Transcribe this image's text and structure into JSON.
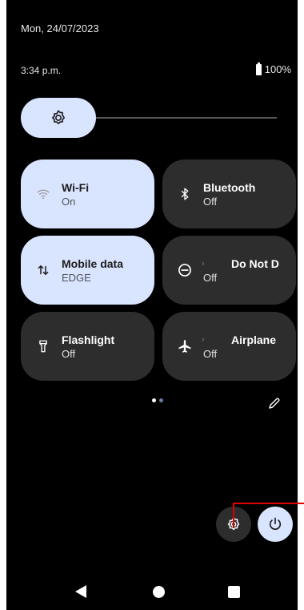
{
  "status": {
    "date": "Mon, 24/07/2023",
    "time": "3:34 p.m.",
    "battery": "100%"
  },
  "brightness": {
    "icon": "brightness-gear-icon",
    "level": 0
  },
  "tiles": [
    {
      "label": "Wi-Fi",
      "status": "On",
      "icon": "wifi-icon",
      "active": true
    },
    {
      "label": "Bluetooth",
      "status": "Off",
      "icon": "bluetooth-icon",
      "active": false
    },
    {
      "label": "Mobile data",
      "status": "EDGE",
      "icon": "mobile-data-arrows-icon",
      "active": true
    },
    {
      "label": "Do Not D",
      "status": "Off",
      "icon": "do-not-disturb-icon",
      "active": false
    },
    {
      "label": "Flashlight",
      "status": "Off",
      "icon": "flashlight-icon",
      "active": false
    },
    {
      "label": "Airplane",
      "status": "Off",
      "icon": "airplane-icon",
      "active": false
    }
  ],
  "pager": {
    "pages": 2,
    "current": 1
  },
  "buttons": {
    "edit": "pencil-icon",
    "settings": "gear-icon",
    "power": "power-icon"
  },
  "nav": {
    "back": "back-triangle-icon",
    "home": "home-circle-icon",
    "recents": "recents-square-icon"
  },
  "colors": {
    "background": "#000000",
    "tile_active": "#d9e4ff",
    "tile_inactive": "#2d2d2d",
    "highlight": "#e00000"
  }
}
